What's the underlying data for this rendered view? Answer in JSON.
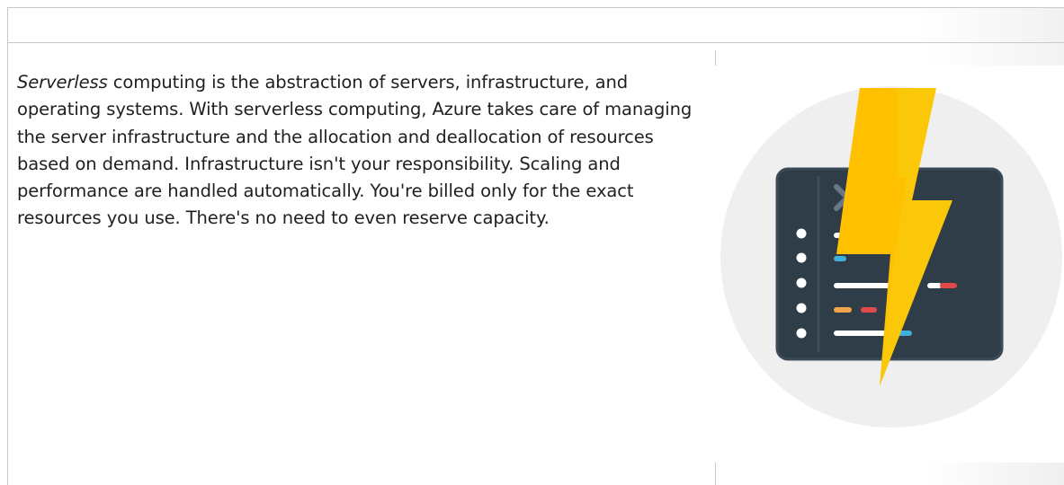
{
  "content": {
    "paragraph": {
      "lead_italic": "Serverless",
      "text": " computing is the abstraction of servers, infrastructure, and operating systems. With serverless computing, Azure takes care of managing the server infrastructure and the allocation and deallocation of resources based on demand. Infrastructure isn't your responsibility. Scaling and performance are handled automatically. You're billed only for the exact resources you use. There's no need to even reserve capacity."
    },
    "image": {
      "icon": "azure-functions-lightning-icon",
      "colors": {
        "circle": "#efefef",
        "window": "#2f3d48",
        "window_border": "#3b4a56",
        "bolt": "#ffc000",
        "bolt_shade": "#f5d312",
        "code_white": "#ffffff",
        "code_red": "#e0494a",
        "code_blue": "#3fb0d9",
        "code_orange": "#f0a54a",
        "chevron": "#687886"
      }
    }
  }
}
